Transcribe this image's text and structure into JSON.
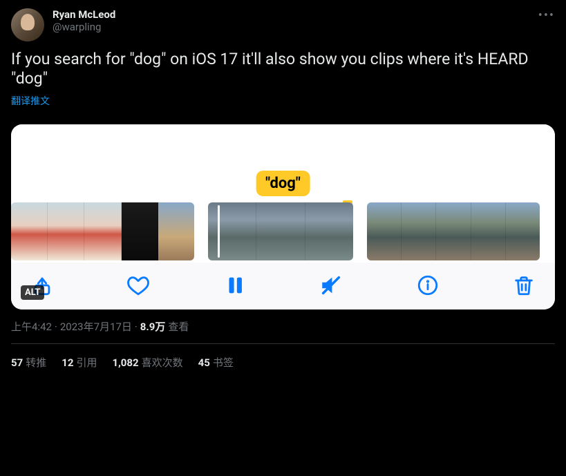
{
  "author": {
    "display_name": "Ryan McLeod",
    "handle": "@warpling"
  },
  "tweet_text": "If you search for \"dog\" on iOS 17 it'll also show you clips where it's HEARD \"dog\"",
  "translate_label": "翻译推文",
  "media": {
    "bubble_text": "\"dog\"",
    "alt_badge": "ALT"
  },
  "meta": {
    "time": "上午4:42",
    "date": "2023年7月17日",
    "views_number": "8.9万",
    "views_label": "查看",
    "separator": " · "
  },
  "stats": {
    "retweets_num": "57",
    "retweets_label": "转推",
    "quotes_num": "12",
    "quotes_label": "引用",
    "likes_num": "1,082",
    "likes_label": "喜欢次数",
    "bookmarks_num": "45",
    "bookmarks_label": "书签"
  }
}
